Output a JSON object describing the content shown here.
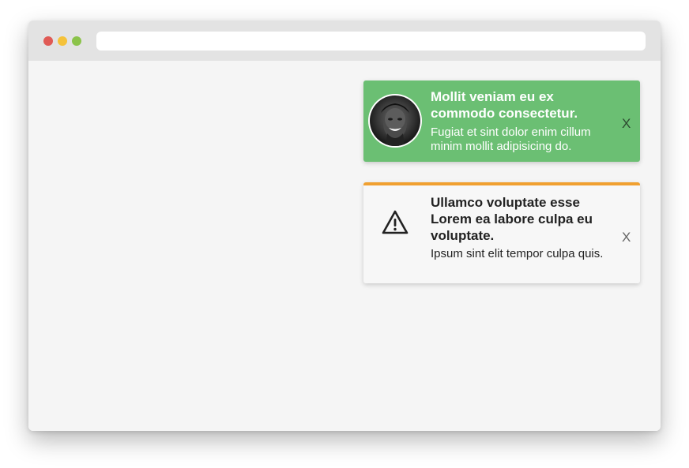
{
  "window": {
    "traffic_lights": {
      "close_color": "#e05a55",
      "minimize_color": "#f5c23a",
      "maximize_color": "#8bc34a"
    }
  },
  "notifications": [
    {
      "kind": "success",
      "background_color": "#6bbf73",
      "text_color": "#ffffff",
      "avatar": "person-photo",
      "title": "Mollit veniam eu ex commodo consectetur.",
      "message": "Fugiat et sint dolor enim cillum minim mollit adipisicing do.",
      "close_label": "X",
      "close_color": "#2e4a30"
    },
    {
      "kind": "warning",
      "accent_color": "#f0a030",
      "text_color": "#222222",
      "icon": "warning-icon",
      "title": "Ullamco voluptate esse Lorem ea labore culpa eu voluptate.",
      "message": "Ipsum sint elit tempor culpa quis.",
      "close_label": "X",
      "close_color": "#666666"
    }
  ]
}
